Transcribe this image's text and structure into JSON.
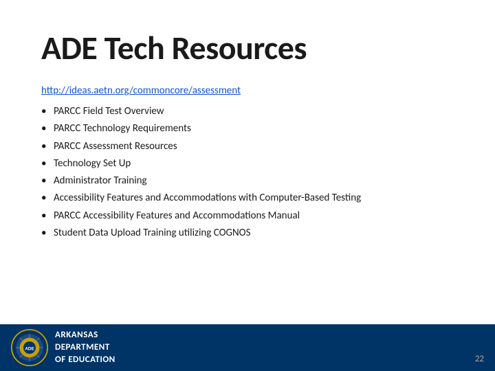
{
  "slide": {
    "title": "ADE Tech Resources",
    "link": {
      "text": "http://ideas.aetn.org/commoncore/assessment",
      "url": "http://ideas.aetn.org/commoncore/assessment"
    },
    "bullets": [
      {
        "text": "PARCC Field Test Overview"
      },
      {
        "text": "PARCC Technology Requirements"
      },
      {
        "text": "PARCC Assessment Resources"
      },
      {
        "text": "Technology Set Up"
      },
      {
        "text": "Administrator Training"
      },
      {
        "text": "Accessibility Features and Accommodations with Computer-Based Testing"
      },
      {
        "text": "PARCC Accessibility Features and Accommodations Manual"
      },
      {
        "text": "Student Data Upload Training utilizing COGNOS"
      }
    ]
  },
  "footer": {
    "org_line1": "Arkansas",
    "org_line2": "Department",
    "org_line3": "of Education"
  },
  "page_number": "22"
}
